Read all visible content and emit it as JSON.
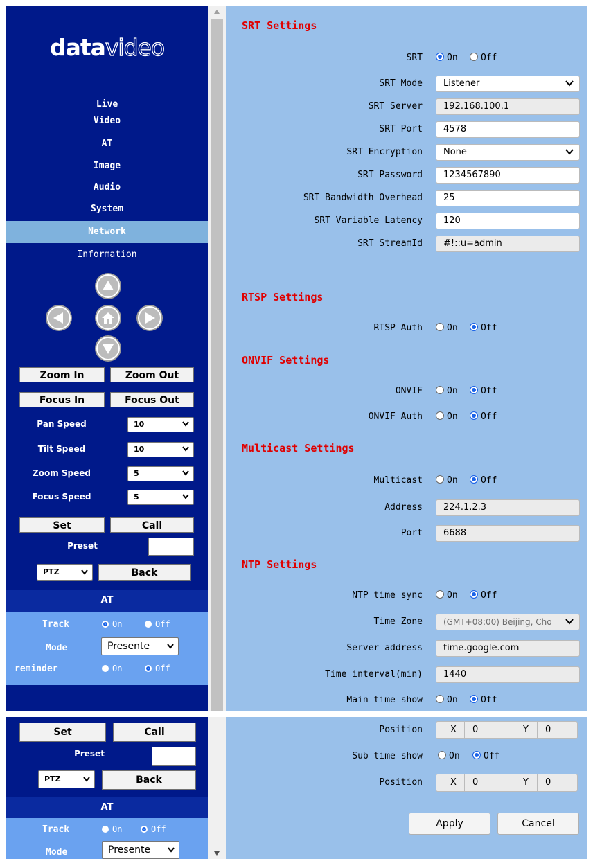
{
  "sidebar": {
    "logo": {
      "part1": "data",
      "part2": "video"
    },
    "nav": [
      "Live",
      "Video",
      "AT",
      "Image",
      "Audio",
      "System",
      "Network",
      "Information"
    ],
    "active_nav": "Network",
    "buttons": {
      "zoom_in": "Zoom In",
      "zoom_out": "Zoom Out",
      "focus_in": "Focus In",
      "focus_out": "Focus Out",
      "set": "Set",
      "call": "Call",
      "back": "Back"
    },
    "speeds": [
      {
        "label": "Pan Speed",
        "value": "10"
      },
      {
        "label": "Tilt Speed",
        "value": "10"
      },
      {
        "label": "Zoom Speed",
        "value": "5"
      },
      {
        "label": "Focus Speed",
        "value": "5"
      }
    ],
    "preset_label": "Preset",
    "ptz_value": "PTZ",
    "at": {
      "title": "AT",
      "track_label": "Track",
      "mode_label": "Mode",
      "mode_value": "Presente",
      "reminder_label": "reminder",
      "on": "On",
      "off": "Off"
    }
  },
  "srt": {
    "heading": "SRT Settings",
    "srt_label": "SRT",
    "srt_value": "On",
    "on": "On",
    "off": "Off",
    "mode_label": "SRT Mode",
    "mode_value": "Listener",
    "server_label": "SRT Server",
    "server_value": "192.168.100.1",
    "port_label": "SRT Port",
    "port_value": "4578",
    "encryption_label": "SRT Encryption",
    "encryption_value": "None",
    "password_label": "SRT Password",
    "password_value": "1234567890",
    "bandwidth_label": "SRT Bandwidth Overhead",
    "bandwidth_value": "25",
    "latency_label": "SRT Variable Latency",
    "latency_value": "120",
    "streamid_label": "SRT StreamId",
    "streamid_value": "#!::u=admin"
  },
  "rtsp": {
    "heading": "RTSP Settings",
    "auth_label": "RTSP Auth",
    "auth_value": "Off"
  },
  "onvif": {
    "heading": "ONVIF Settings",
    "onvif_label": "ONVIF",
    "onvif_value": "Off",
    "auth_label": "ONVIF Auth",
    "auth_value": "Off"
  },
  "multicast": {
    "heading": "Multicast Settings",
    "multicast_label": "Multicast",
    "multicast_value": "Off",
    "address_label": "Address",
    "address_value": "224.1.2.3",
    "port_label": "Port",
    "port_value": "6688"
  },
  "ntp": {
    "heading": "NTP Settings",
    "sync_label": "NTP time sync",
    "sync_value": "Off",
    "timezone_label": "Time Zone",
    "timezone_value": "(GMT+08:00) Beijing, Cho",
    "server_label": "Server address",
    "server_value": "time.google.com",
    "interval_label": "Time interval(min)",
    "interval_value": "1440",
    "main_show_label": "Main time show",
    "main_show_value": "Off"
  },
  "time_position": {
    "position_label": "Position",
    "x_label": "X",
    "y_label": "Y",
    "main_x": "0",
    "main_y": "0",
    "sub_show_label": "Sub time show",
    "sub_show_value": "Off",
    "sub_x": "0",
    "sub_y": "0"
  },
  "actions": {
    "apply": "Apply",
    "cancel": "Cancel"
  },
  "colors": {
    "sidebar_bg": "#00198a",
    "main_bg": "#99c0ea",
    "heading": "#e00000",
    "active_nav": "#7fb2dd",
    "at_panel": "#6aa2f0"
  }
}
